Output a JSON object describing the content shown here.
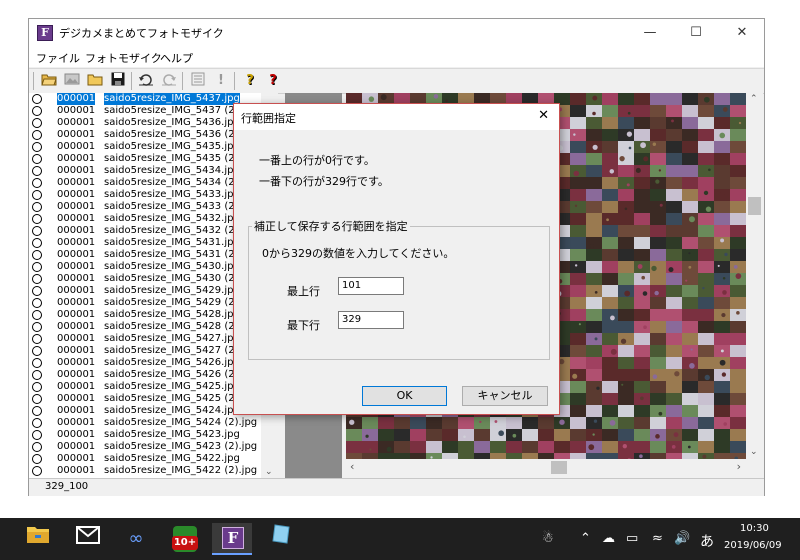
{
  "window": {
    "title": "デジカメまとめてフォトモザイク",
    "icon_letter": "F",
    "minimize": "—",
    "maximize": "☐",
    "close": "✕"
  },
  "menu": [
    "ファイル",
    "フォトモザイク",
    "ヘルプ"
  ],
  "toolbar_icons": [
    "open-folder-icon",
    "image-icon",
    "folder-icon",
    "save-icon",
    "undo-icon",
    "redo-icon",
    "list-icon",
    "exclamation-icon",
    "help-icon",
    "help-context-icon"
  ],
  "list": {
    "rows": [
      {
        "num": "000001",
        "file": "saido5resize_IMG_5437.jpg"
      },
      {
        "num": "000001",
        "file": "saido5resize_IMG_5437 (2"
      },
      {
        "num": "000001",
        "file": "saido5resize_IMG_5436.jp"
      },
      {
        "num": "000001",
        "file": "saido5resize_IMG_5436 (2"
      },
      {
        "num": "000001",
        "file": "saido5resize_IMG_5435.jp"
      },
      {
        "num": "000001",
        "file": "saido5resize_IMG_5435 (2"
      },
      {
        "num": "000001",
        "file": "saido5resize_IMG_5434.jp"
      },
      {
        "num": "000001",
        "file": "saido5resize_IMG_5434 (2"
      },
      {
        "num": "000001",
        "file": "saido5resize_IMG_5433.jp"
      },
      {
        "num": "000001",
        "file": "saido5resize_IMG_5433 (2"
      },
      {
        "num": "000001",
        "file": "saido5resize_IMG_5432.jp"
      },
      {
        "num": "000001",
        "file": "saido5resize_IMG_5432 (2"
      },
      {
        "num": "000001",
        "file": "saido5resize_IMG_5431.jp"
      },
      {
        "num": "000001",
        "file": "saido5resize_IMG_5431 (2"
      },
      {
        "num": "000001",
        "file": "saido5resize_IMG_5430.jp"
      },
      {
        "num": "000001",
        "file": "saido5resize_IMG_5430 (2"
      },
      {
        "num": "000001",
        "file": "saido5resize_IMG_5429.jp"
      },
      {
        "num": "000001",
        "file": "saido5resize_IMG_5429 (2"
      },
      {
        "num": "000001",
        "file": "saido5resize_IMG_5428.jp"
      },
      {
        "num": "000001",
        "file": "saido5resize_IMG_5428 (2"
      },
      {
        "num": "000001",
        "file": "saido5resize_IMG_5427.jp"
      },
      {
        "num": "000001",
        "file": "saido5resize_IMG_5427 (2"
      },
      {
        "num": "000001",
        "file": "saido5resize_IMG_5426.jp"
      },
      {
        "num": "000001",
        "file": "saido5resize_IMG_5426 (2"
      },
      {
        "num": "000001",
        "file": "saido5resize_IMG_5425.jp"
      },
      {
        "num": "000001",
        "file": "saido5resize_IMG_5425 (2"
      },
      {
        "num": "000001",
        "file": "saido5resize_IMG_5424.jp"
      },
      {
        "num": "000001",
        "file": "saido5resize_IMG_5424 (2).jpg"
      },
      {
        "num": "000001",
        "file": "saido5resize_IMG_5423.jpg"
      },
      {
        "num": "000001",
        "file": "saido5resize_IMG_5423 (2).jpg"
      },
      {
        "num": "000001",
        "file": "saido5resize_IMG_5422.jpg"
      },
      {
        "num": "000001",
        "file": "saido5resize_IMG_5422 (2).jpg"
      }
    ],
    "selected_index": 0
  },
  "statusbar": {
    "text": "329_100"
  },
  "dialog": {
    "title": "行範囲指定",
    "close": "✕",
    "top_row_text": "一番上の行が0行です。",
    "bottom_row_text": "一番下の行が329行です。",
    "group_label": "補正して保存する行範囲を指定",
    "instruction": "0から329の数値を入力してください。",
    "top_label": "最上行",
    "top_value": "101",
    "bottom_label": "最下行",
    "bottom_value": "329",
    "ok_label": "OK",
    "cancel_label": "キャンセル"
  },
  "taskbar": {
    "time": "10:30",
    "date": "2019/06/09",
    "ime": "あ",
    "badge": "10+"
  },
  "colors": {
    "selection": "#0078d7",
    "dialog_border": "#c85050",
    "taskbar": "#1f1f1f"
  }
}
